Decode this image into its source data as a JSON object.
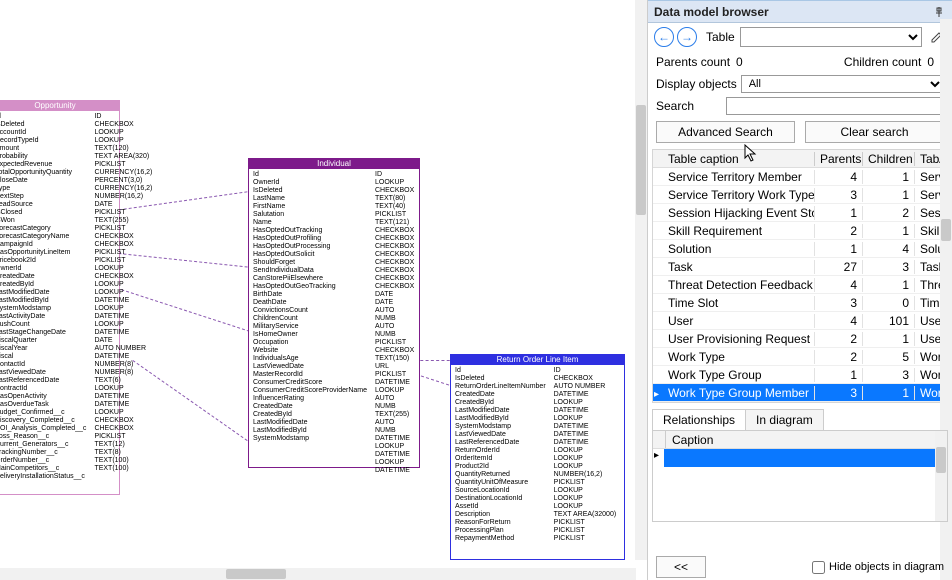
{
  "panel": {
    "title": "Data model browser",
    "nav_label": "Table",
    "table_select_value": "",
    "parents_count_label": "Parents count",
    "parents_count": "0",
    "children_count_label": "Children count",
    "children_count": "0",
    "display_objects_label": "Display objects",
    "display_objects_value": "All",
    "search_label": "Search",
    "search_value": "",
    "advanced_search_btn": "Advanced Search",
    "clear_search_btn": "Clear search"
  },
  "grid": {
    "columns": [
      "Table caption",
      "Parents",
      "Children",
      "Tabl"
    ],
    "rows": [
      {
        "caption": "Service Territory Member",
        "p": 4,
        "c": 1,
        "last": "Serv"
      },
      {
        "caption": "Service Territory Work Type",
        "p": 3,
        "c": 1,
        "last": "Serv"
      },
      {
        "caption": "Session Hijacking Event Store",
        "p": 1,
        "c": 2,
        "last": "Sess"
      },
      {
        "caption": "Skill Requirement",
        "p": 2,
        "c": 1,
        "last": "Skill"
      },
      {
        "caption": "Solution",
        "p": 1,
        "c": 4,
        "last": "Solu"
      },
      {
        "caption": "Task",
        "p": 27,
        "c": 3,
        "last": "Task"
      },
      {
        "caption": "Threat Detection Feedback",
        "p": 4,
        "c": 1,
        "last": "Thre"
      },
      {
        "caption": "Time Slot",
        "p": 3,
        "c": 0,
        "last": "Time"
      },
      {
        "caption": "User",
        "p": 4,
        "c": 101,
        "last": "User"
      },
      {
        "caption": "User Provisioning Request",
        "p": 2,
        "c": 1,
        "last": "User"
      },
      {
        "caption": "Work Type",
        "p": 2,
        "c": 5,
        "last": "Wor"
      },
      {
        "caption": "Work Type Group",
        "p": 1,
        "c": 3,
        "last": "Wor"
      },
      {
        "caption": "Work Type Group Member",
        "p": 3,
        "c": 1,
        "last": "Wor",
        "selected": true
      }
    ]
  },
  "tabs": {
    "tab1": "Relationships",
    "tab2": "In diagram",
    "caption_header": "Caption"
  },
  "footer": {
    "collapse_btn": "<<",
    "hide_label": "Hide objects in diagram",
    "hide_checked": false
  },
  "entities": {
    "opportunity": {
      "title": "Opportunity",
      "fields": [
        "Id",
        "IsDeleted",
        "AccountId",
        "RecordTypeId",
        "Amount",
        "Probability",
        "ExpectedRevenue",
        "TotalOpportunityQuantity",
        "CloseDate",
        "Type",
        "NextStep",
        "LeadSource",
        "IsClosed",
        "IsWon",
        "ForecastCategory",
        "ForecastCategoryName",
        "CampaignId",
        "HasOpportunityLineItem",
        "Pricebook2Id",
        "OwnerId",
        "CreatedDate",
        "CreatedById",
        "LastModifiedDate",
        "LastModifiedById",
        "SystemModstamp",
        "LastActivityDate",
        "PushCount",
        "LastStageChangeDate",
        "FiscalQuarter",
        "FiscalYear",
        "Fiscal",
        "ContactId",
        "LastViewedDate",
        "LastReferencedDate",
        "ContractId",
        "HasOpenActivity",
        "HasOverdueTask",
        "Budget_Confirmed__c",
        "Discovery_Completed__c",
        "ROI_Analysis_Completed__c",
        "Loss_Reason__c",
        "Current_Generators__c",
        "TrackingNumber__c",
        "OrderNumber__c",
        "MainCompetitors__c",
        "DeliveryInstallationStatus__c"
      ],
      "types": [
        "ID",
        "CHECKBOX",
        "LOOKUP",
        "LOOKUP",
        "TEXT(120)",
        "TEXT AREA(320)",
        "PICKLIST",
        "CURRENCY(16,2)",
        "PERCENT(3,0)",
        "CURRENCY(16,2)",
        "NUMBER(16,2)",
        "DATE",
        "PICKLIST",
        "TEXT(255)",
        "PICKLIST",
        "CHECKBOX",
        "CHECKBOX",
        "PICKLIST",
        "PICKLIST",
        "LOOKUP",
        "CHECKBOX",
        "LOOKUP",
        "LOOKUP",
        "DATETIME",
        "LOOKUP",
        "DATETIME",
        "LOOKUP",
        "DATETIME",
        "DATE",
        "AUTO NUMBER",
        "DATETIME",
        "NUMBER(8)",
        "NUMBER(8)",
        "TEXT(6)",
        "LOOKUP",
        "DATETIME",
        "DATETIME",
        "LOOKUP",
        "CHECKBOX",
        "CHECKBOX",
        "PICKLIST",
        "TEXT(12)",
        "TEXT(8)",
        "TEXT(100)",
        "TEXT(100)"
      ]
    },
    "individual": {
      "title": "Individual",
      "fields": [
        "Id",
        "OwnerId",
        "IsDeleted",
        "LastName",
        "FirstName",
        "Salutation",
        "Name",
        "HasOptedOutTracking",
        "HasOptedOutProfiling",
        "HasOptedOutProcessing",
        "HasOptedOutSolicit",
        "ShouldForget",
        "SendIndividualData",
        "CanStorePiiElsewhere",
        "HasOptedOutGeoTracking",
        "BirthDate",
        "DeathDate",
        "ConvictionsCount",
        "ChildrenCount",
        "MilitaryService",
        "IsHomeOwner",
        "Occupation",
        "Website",
        "IndividualsAge",
        "LastViewedDate",
        "MasterRecordId",
        "ConsumerCreditScore",
        "ConsumerCreditScoreProviderName",
        "InfluencerRating",
        "CreatedDate",
        "CreatedById",
        "LastModifiedDate",
        "LastModifiedById",
        "SystemModstamp"
      ],
      "types": [
        "ID",
        "LOOKUP",
        "CHECKBOX",
        "TEXT(80)",
        "TEXT(40)",
        "PICKLIST",
        "TEXT(121)",
        "CHECKBOX",
        "CHECKBOX",
        "CHECKBOX",
        "CHECKBOX",
        "CHECKBOX",
        "CHECKBOX",
        "CHECKBOX",
        "CHECKBOX",
        "DATE",
        "DATE",
        "AUTO NUMB",
        "AUTO NUMB",
        "PICKLIST",
        "CHECKBOX",
        "TEXT(150)",
        "URL",
        "PICKLIST",
        "DATETIME",
        "LOOKUP",
        "AUTO NUMB",
        "TEXT(255)",
        "AUTO NUMB",
        "DATETIME",
        "LOOKUP",
        "DATETIME",
        "LOOKUP",
        "DATETIME"
      ]
    },
    "roli": {
      "title": "Return Order Line Item",
      "fields": [
        "Id",
        "IsDeleted",
        "ReturnOrderLineItemNumber",
        "CreatedDate",
        "CreatedById",
        "LastModifiedDate",
        "LastModifiedById",
        "SystemModstamp",
        "LastViewedDate",
        "LastReferencedDate",
        "ReturnOrderId",
        "OrderItemId",
        "Product2Id",
        "QuantityReturned",
        "QuantityUnitOfMeasure",
        "SourceLocationId",
        "DestinationLocationId",
        "AssetId",
        "Description",
        "ReasonForReturn",
        "ProcessingPlan",
        "RepaymentMethod"
      ],
      "types": [
        "ID",
        "CHECKBOX",
        "AUTO NUMBER",
        "DATETIME",
        "LOOKUP",
        "DATETIME",
        "LOOKUP",
        "DATETIME",
        "DATETIME",
        "DATETIME",
        "LOOKUP",
        "LOOKUP",
        "LOOKUP",
        "NUMBER(16,2)",
        "PICKLIST",
        "LOOKUP",
        "LOOKUP",
        "LOOKUP",
        "TEXT AREA(32000)",
        "PICKLIST",
        "PICKLIST",
        "PICKLIST"
      ]
    }
  }
}
